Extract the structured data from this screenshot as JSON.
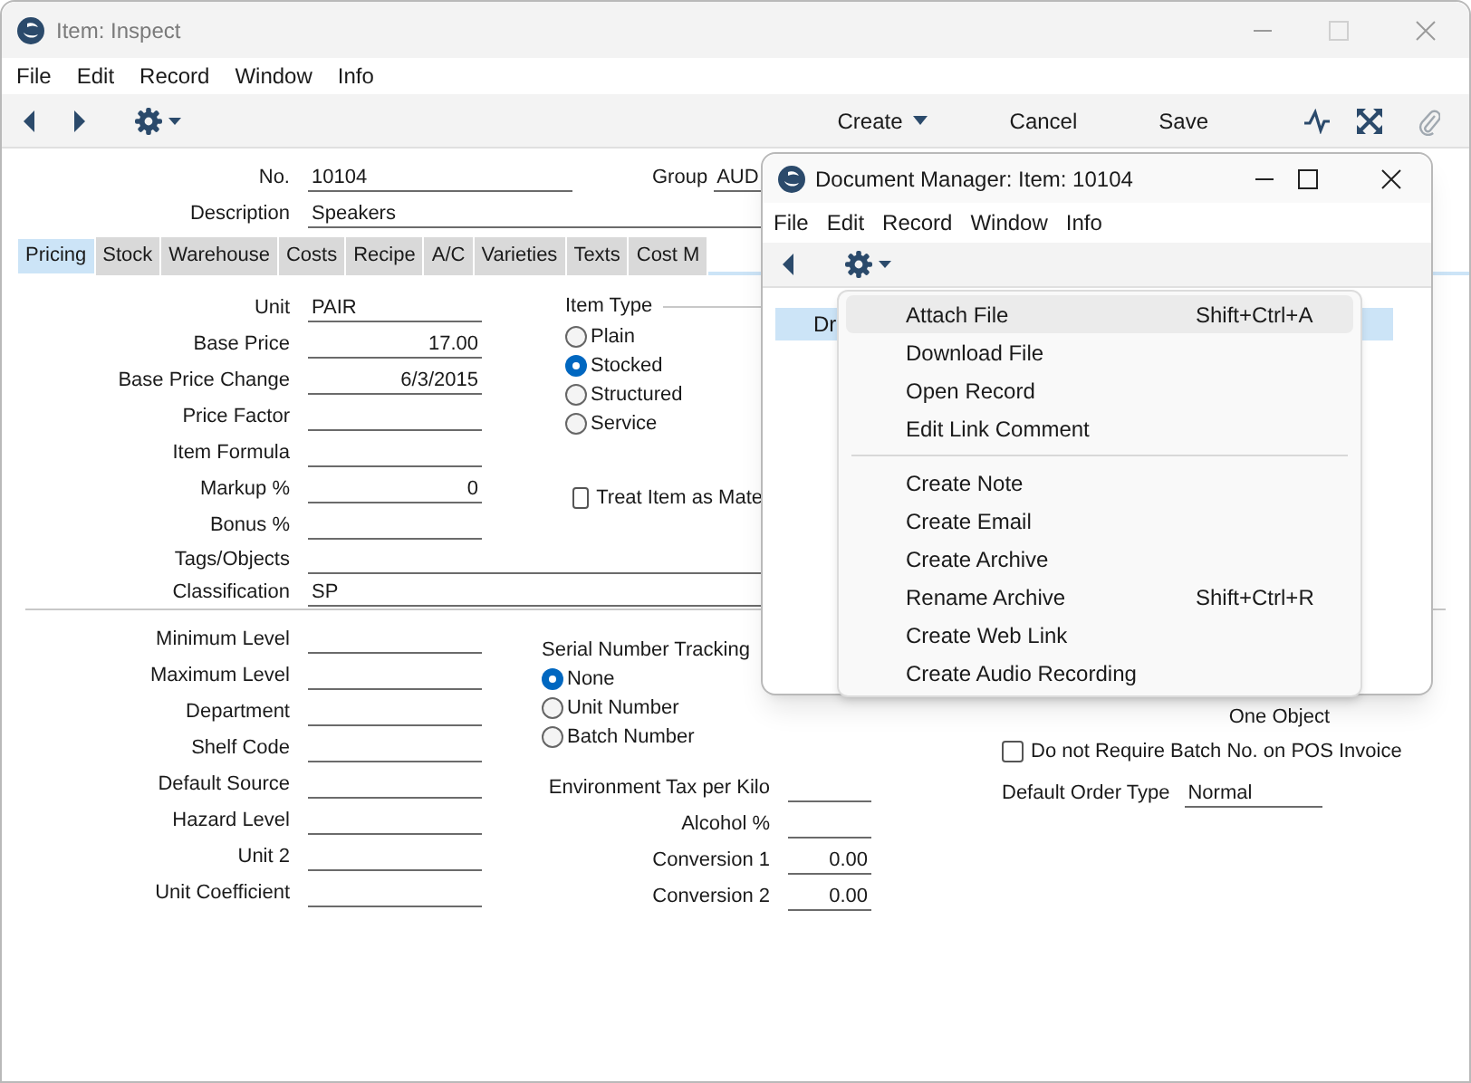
{
  "window": {
    "title": "Item: Inspect"
  },
  "menu": [
    "File",
    "Edit",
    "Record",
    "Window",
    "Info"
  ],
  "toolbar": {
    "buttons": [
      {
        "label": "Create",
        "dropdown": true
      },
      {
        "label": "Cancel",
        "dropdown": false
      },
      {
        "label": "Save",
        "dropdown": false
      }
    ]
  },
  "header": {
    "fields": [
      {
        "label": "No.",
        "value": "10104",
        "kind": "medium"
      },
      {
        "label": "Description",
        "value": "Speakers",
        "kind": "long"
      }
    ],
    "group": {
      "label": "Group",
      "value": "AUD"
    }
  },
  "tabs": [
    {
      "label": "Pricing",
      "selected": true
    },
    {
      "label": "Stock",
      "selected": false
    },
    {
      "label": "Warehouse",
      "selected": false
    },
    {
      "label": "Costs",
      "selected": false
    },
    {
      "label": "Recipe",
      "selected": false
    },
    {
      "label": "A/C",
      "selected": false
    },
    {
      "label": "Varieties",
      "selected": false
    },
    {
      "label": "Texts",
      "selected": false
    },
    {
      "label": "Cost M",
      "selected": false
    }
  ],
  "pricing": {
    "fields": [
      {
        "label": "Unit",
        "value": "PAIR",
        "numeric": false,
        "kind": "short"
      },
      {
        "label": "Base Price",
        "value": "17.00",
        "numeric": true,
        "kind": "short"
      },
      {
        "label": "Base Price Change",
        "value": "6/3/2015",
        "numeric": true,
        "kind": "short"
      },
      {
        "label": "Price Factor",
        "kind": "short"
      },
      {
        "label": "Item Formula",
        "kind": "short"
      },
      {
        "label": "Markup %",
        "value": "0",
        "numeric": true,
        "kind": "short"
      },
      {
        "label": "Bonus %",
        "kind": "short"
      },
      {
        "label": "Tags/Objects",
        "kind": "long"
      },
      {
        "label": "Classification",
        "value": "SP",
        "numeric": false,
        "kind": "long"
      }
    ],
    "item_type": {
      "label": "Item Type",
      "options": [
        {
          "label": "Plain",
          "selected": false
        },
        {
          "label": "Stocked",
          "selected": true
        },
        {
          "label": "Structured",
          "selected": false
        },
        {
          "label": "Service",
          "selected": false
        }
      ]
    },
    "checkbox": {
      "label": "Treat Item as Mate",
      "checked": false
    }
  },
  "stock": {
    "fields": [
      {
        "label": "Minimum Level"
      },
      {
        "label": "Maximum Level"
      },
      {
        "label": "Department"
      },
      {
        "label": "Shelf Code"
      },
      {
        "label": "Default Source"
      },
      {
        "label": "Hazard Level"
      },
      {
        "label": "Unit 2"
      },
      {
        "label": "Unit Coefficient"
      }
    ],
    "serial_tracking": {
      "label": "Serial Number Tracking",
      "options": [
        {
          "label": "None",
          "selected": true
        },
        {
          "label": "Unit Number",
          "selected": false
        },
        {
          "label": "Batch Number",
          "selected": false
        }
      ]
    },
    "middle_fields": [
      {
        "label": "Environment Tax per Kilo"
      },
      {
        "label": "Alcohol %"
      },
      {
        "label": "Conversion 1",
        "value": "0.00",
        "numeric": true
      },
      {
        "label": "Conversion 2",
        "value": "0.00",
        "numeric": true
      }
    ],
    "one_object": "One Object",
    "checkbox": {
      "label": "Do not Require Batch No. on POS Invoice",
      "checked": false
    },
    "default_order_type": {
      "label": "Default Order Type",
      "value": "Normal"
    }
  },
  "document_manager": {
    "title": "Document Manager: Item: 10104",
    "menu": [
      "File",
      "Edit",
      "Record",
      "Window",
      "Info"
    ],
    "table_header": "Dr",
    "menu_groups": [
      [
        {
          "label": "Attach File",
          "shortcut": "Shift+Ctrl+A",
          "highlighted": true
        },
        {
          "label": "Download File",
          "highlighted": false
        },
        {
          "label": "Open Record",
          "highlighted": false
        },
        {
          "label": "Edit Link Comment",
          "highlighted": false
        }
      ],
      [
        {
          "label": "Create Note",
          "highlighted": false
        },
        {
          "label": "Create Email",
          "highlighted": false
        },
        {
          "label": "Create Archive",
          "highlighted": false
        },
        {
          "label": "Rename Archive",
          "shortcut": "Shift+Ctrl+R",
          "highlighted": false
        },
        {
          "label": "Create Web Link",
          "highlighted": false
        },
        {
          "label": "Create Audio Recording",
          "highlighted": false
        }
      ]
    ]
  }
}
